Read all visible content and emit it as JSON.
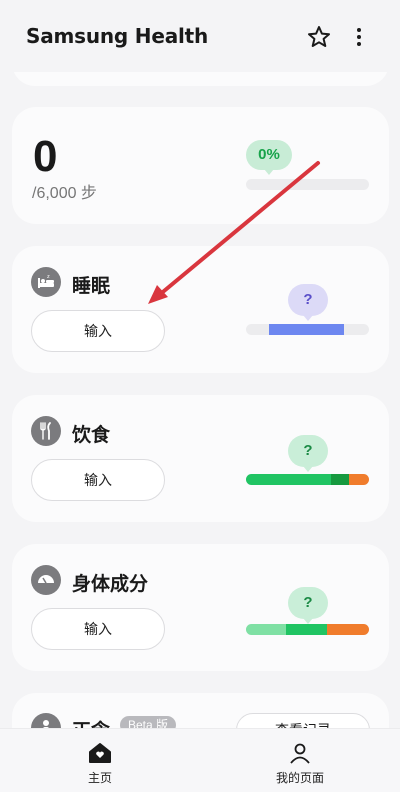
{
  "app": {
    "title": "Samsung Health"
  },
  "steps": {
    "value": "0",
    "goal": "/6,000 步",
    "percent": "0%",
    "progress": 0.0
  },
  "sleep": {
    "title": "睡眠",
    "input_label": "输入",
    "bubble": "?",
    "color": "#6d87f0"
  },
  "food": {
    "title": "饮食",
    "input_label": "输入",
    "bubble": "?",
    "segments": [
      {
        "color": "#20c463"
      },
      {
        "color": "#16993f"
      },
      {
        "color": "#f07c2c"
      }
    ]
  },
  "body": {
    "title": "身体成分",
    "input_label": "输入",
    "bubble": "?",
    "segments": [
      {
        "color": "#7fe0a4"
      },
      {
        "color": "#20c463"
      },
      {
        "color": "#f07c2c"
      }
    ]
  },
  "partial": {
    "title": "正念",
    "badge": "Beta 版",
    "history_label": "查看记录"
  },
  "nav": {
    "home": "主页",
    "my_page": "我的页面"
  },
  "colors": {
    "accent_green": "#17a34a",
    "arrow": "#d9363e"
  }
}
